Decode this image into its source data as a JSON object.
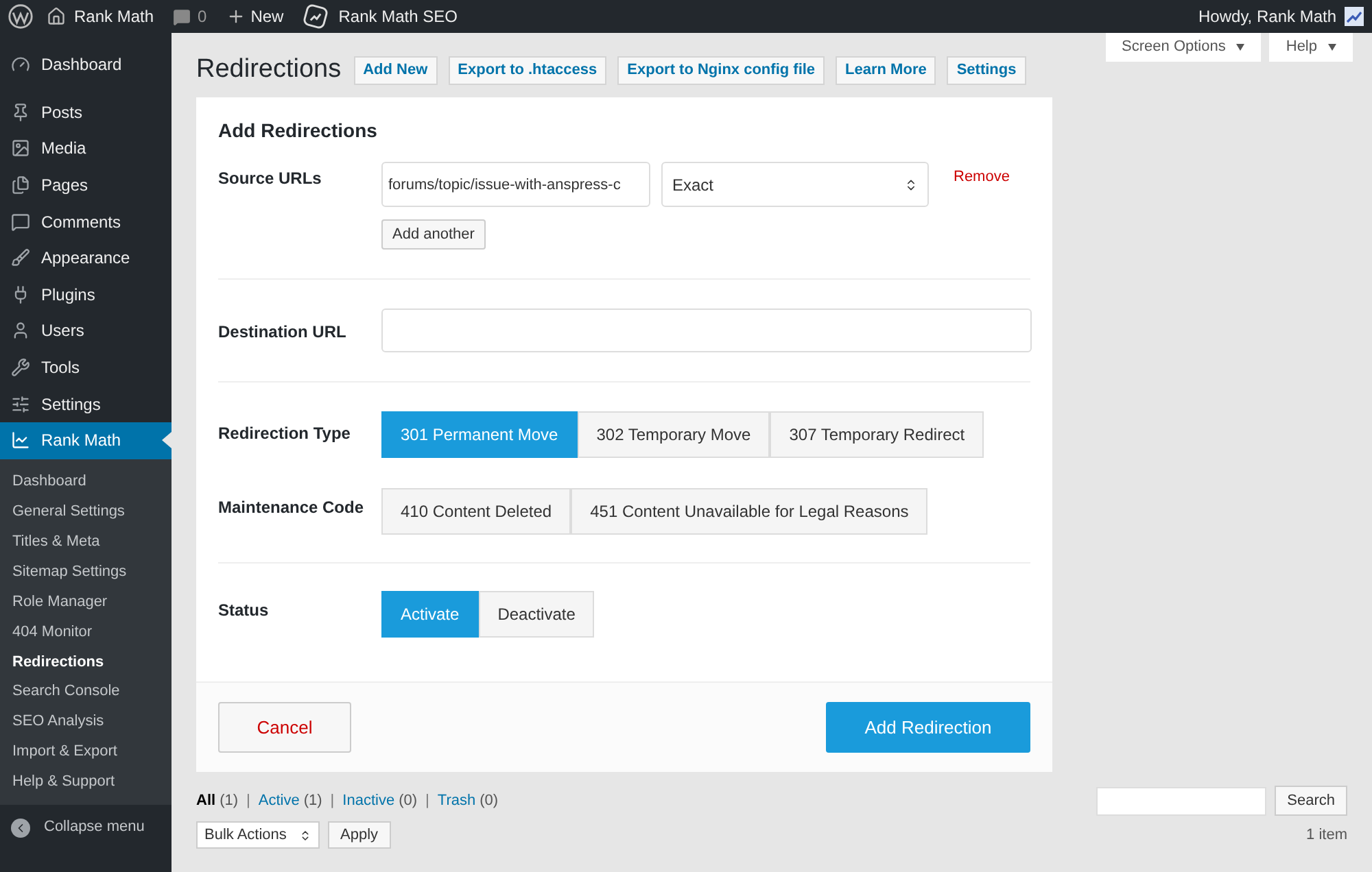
{
  "admin_bar": {
    "site": "Rank Math",
    "comments": "0",
    "new": "New",
    "plugin": "Rank Math SEO",
    "greeting": "Howdy, Rank Math"
  },
  "sidebar": {
    "items": [
      {
        "label": "Dashboard",
        "selected": false
      },
      {
        "label": "Posts",
        "selected": false
      },
      {
        "label": "Media",
        "selected": false
      },
      {
        "label": "Pages",
        "selected": false
      },
      {
        "label": "Comments",
        "selected": false
      },
      {
        "label": "Appearance",
        "selected": false
      },
      {
        "label": "Plugins",
        "selected": false
      },
      {
        "label": "Users",
        "selected": false
      },
      {
        "label": "Tools",
        "selected": false
      },
      {
        "label": "Settings",
        "selected": false
      },
      {
        "label": "Rank Math",
        "selected": true
      }
    ],
    "submenu": [
      {
        "label": "Dashboard",
        "selected": false
      },
      {
        "label": "General Settings",
        "selected": false
      },
      {
        "label": "Titles & Meta",
        "selected": false
      },
      {
        "label": "Sitemap Settings",
        "selected": false
      },
      {
        "label": "Role Manager",
        "selected": false
      },
      {
        "label": "404 Monitor",
        "selected": false
      },
      {
        "label": "Redirections",
        "selected": true
      },
      {
        "label": "Search Console",
        "selected": false
      },
      {
        "label": "SEO Analysis",
        "selected": false
      },
      {
        "label": "Import & Export",
        "selected": false
      },
      {
        "label": "Help & Support",
        "selected": false
      }
    ],
    "collapse": "Collapse menu"
  },
  "screen_meta": [
    "Screen Options",
    "Help"
  ],
  "page": {
    "title": "Redirections",
    "actions": [
      "Add New",
      "Export to .htaccess",
      "Export to Nginx config file",
      "Learn More",
      "Settings"
    ]
  },
  "form": {
    "title": "Add Redirections",
    "source": {
      "label": "Source URLs",
      "value": "forums/topic/issue-with-anspress-c",
      "match": "Exact",
      "remove": "Remove",
      "add": "Add another"
    },
    "destination": {
      "label": "Destination URL"
    },
    "type": {
      "label": "Redirection Type",
      "options": [
        {
          "label": "301 Permanent Move",
          "selected": true
        },
        {
          "label": "302 Temporary Move",
          "selected": false
        },
        {
          "label": "307 Temporary Redirect",
          "selected": false
        }
      ]
    },
    "maintenance": {
      "label": "Maintenance Code",
      "options": [
        {
          "label": "410 Content Deleted",
          "selected": false
        },
        {
          "label": "451 Content Unavailable for Legal Reasons",
          "selected": false
        }
      ]
    },
    "status": {
      "label": "Status",
      "options": [
        {
          "label": "Activate",
          "selected": true
        },
        {
          "label": "Deactivate",
          "selected": false
        }
      ]
    },
    "cancel": "Cancel",
    "submit": "Add Redirection"
  },
  "list": {
    "filters": [
      {
        "label": "All",
        "count": "(1)",
        "selected": true
      },
      {
        "label": "Active",
        "count": "(1)",
        "selected": false
      },
      {
        "label": "Inactive",
        "count": "(0)",
        "selected": false
      },
      {
        "label": "Trash",
        "count": "(0)",
        "selected": false
      }
    ],
    "separator": "|",
    "search_button": "Search",
    "bulk": "Bulk Actions",
    "apply": "Apply",
    "count": "1 item"
  }
}
